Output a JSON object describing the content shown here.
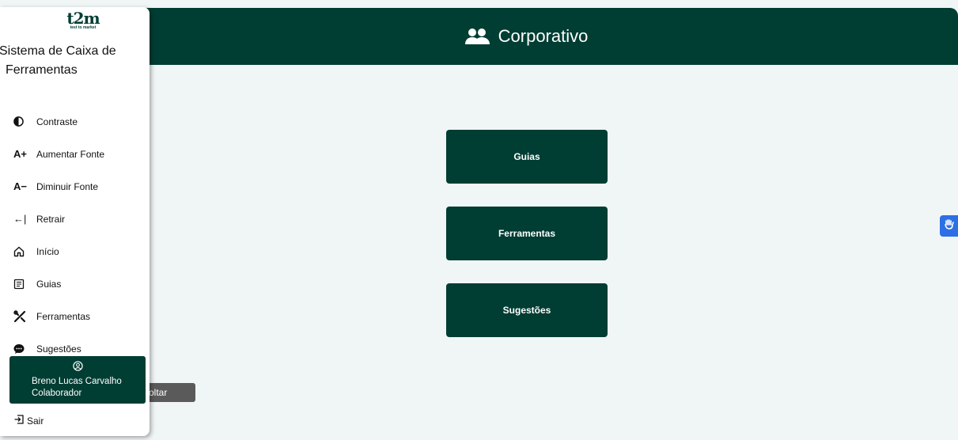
{
  "header": {
    "title": "Corporativo",
    "icon": "users-icon"
  },
  "sidebar": {
    "logo_main": "t2m",
    "logo_sub": "test to market",
    "title": "Sistema de Caixa de Ferramentas",
    "items": [
      {
        "label": "Contraste",
        "icon": "contrast-icon"
      },
      {
        "label": "Aumentar Fonte",
        "icon": "font-increase-icon",
        "glyph": "A+"
      },
      {
        "label": "Diminuir Fonte",
        "icon": "font-decrease-icon",
        "glyph": "A−"
      },
      {
        "label": "Retrair",
        "icon": "collapse-icon",
        "glyph": "←|"
      },
      {
        "label": "Início",
        "icon": "home-icon"
      },
      {
        "label": "Guias",
        "icon": "guide-icon"
      },
      {
        "label": "Ferramentas",
        "icon": "tools-icon"
      },
      {
        "label": "Sugestões",
        "icon": "chat-icon"
      }
    ],
    "user": {
      "name": "Breno Lucas Carvalho",
      "role": "Colaborador"
    },
    "logout_label": "Sair"
  },
  "main": {
    "buttons": [
      {
        "label": "Guias"
      },
      {
        "label": "Ferramentas"
      },
      {
        "label": "Sugestões"
      }
    ],
    "back_label": "oltar"
  },
  "colors": {
    "primary": "#003d33",
    "background": "#f0f5f5",
    "accessibility": "#2d6fe5"
  }
}
